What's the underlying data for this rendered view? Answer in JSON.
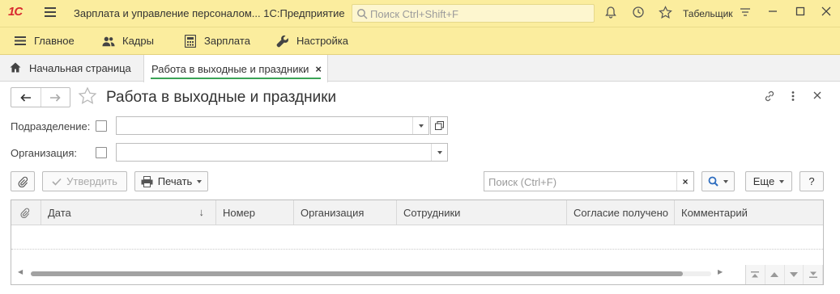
{
  "titlebar": {
    "logo": "1С",
    "app_title": "Зарплата и управление персоналом... 1С:Предприятие",
    "search_placeholder": "Поиск Ctrl+Shift+F",
    "user": "Табельщик"
  },
  "menubar": {
    "items": [
      {
        "label": "Главное",
        "icon": "hamburger-icon"
      },
      {
        "label": "Кадры",
        "icon": "people-icon"
      },
      {
        "label": "Зарплата",
        "icon": "calculator-icon"
      },
      {
        "label": "Настройка",
        "icon": "wrench-icon"
      }
    ]
  },
  "tabs": [
    {
      "label": "Начальная страница",
      "icon": "home-icon"
    },
    {
      "label": "Работа в выходные и праздники",
      "close": "×"
    }
  ],
  "form": {
    "title": "Работа в выходные и праздники",
    "fields": {
      "department_label": "Подразделение:",
      "organization_label": "Организация:"
    },
    "commands": {
      "approve": "Утвердить",
      "print": "Печать",
      "search_placeholder": "Поиск (Ctrl+F)",
      "search_clear": "×",
      "more": "Еще",
      "help": "?"
    },
    "table": {
      "columns": [
        "Дата",
        "Номер",
        "Организация",
        "Сотрудники",
        "Согласие получено",
        "Комментарий"
      ],
      "sort_indicator": "↓",
      "rows": []
    }
  },
  "colors": {
    "chrome_yellow": "#fbed9e",
    "active_tab_accent": "#3aa356"
  }
}
